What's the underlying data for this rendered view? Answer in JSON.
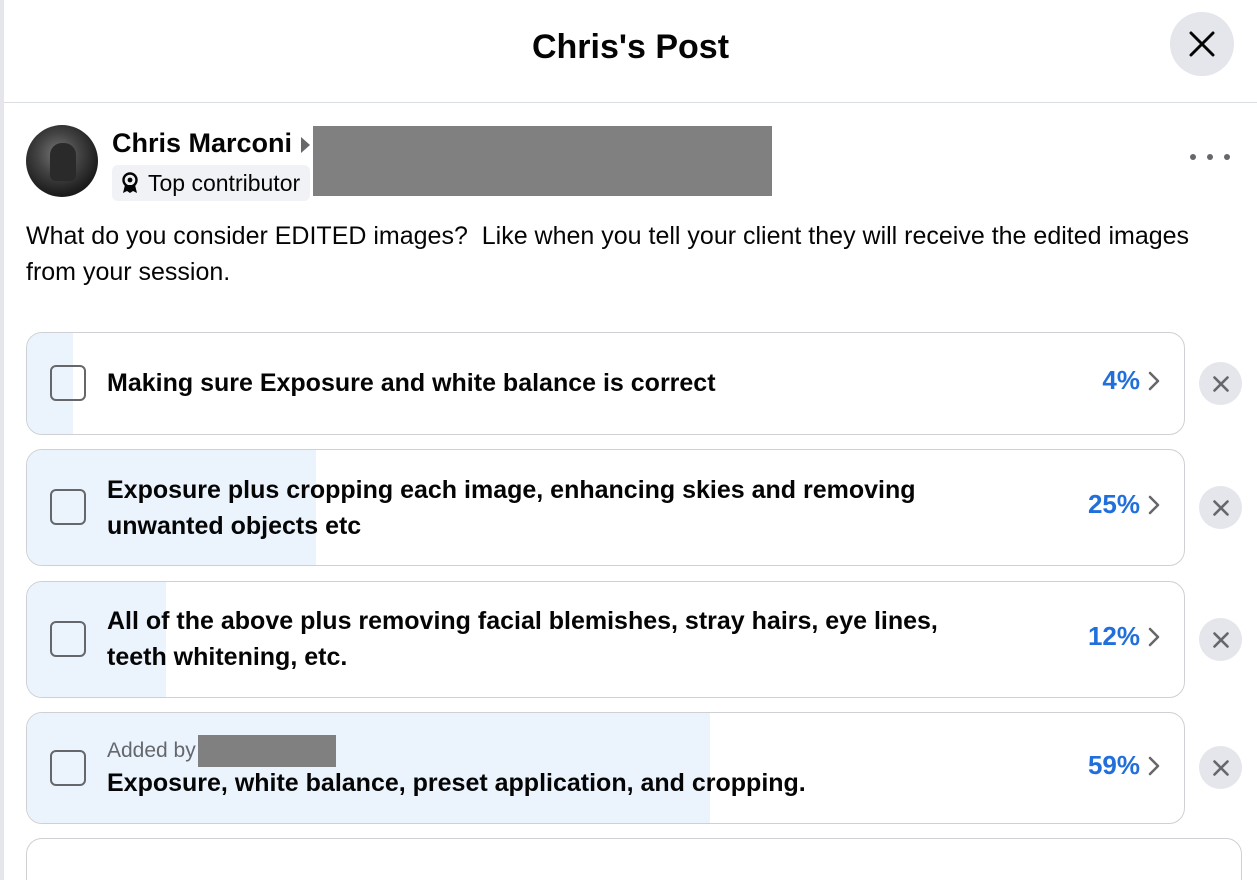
{
  "header": {
    "title": "Chris's Post"
  },
  "post": {
    "author": {
      "name": "Chris Marconi",
      "badge": "Top contributor"
    },
    "text": "What do you consider EDITED images?  Like when you tell your client they will receive the edited images from your session."
  },
  "poll": {
    "options": [
      {
        "text": "Making sure Exposure and white balance is correct",
        "percent": "4%",
        "value": 4,
        "added_by": ""
      },
      {
        "text": "Exposure plus cropping each image, enhancing skies and removing unwanted objects etc",
        "percent": "25%",
        "value": 25,
        "added_by": ""
      },
      {
        "text": "All of the above plus removing facial blemishes, stray hairs, eye lines, teeth whitening, etc.",
        "percent": "12%",
        "value": 12,
        "added_by": ""
      },
      {
        "text": "Exposure, white balance, preset application, and cropping.",
        "percent": "59%",
        "value": 59,
        "added_by": "Added by"
      }
    ],
    "add_option_placeholder": ""
  },
  "colors": {
    "accent": "#216fdb",
    "fill": "#ebf3fd",
    "border": "#ced0d4",
    "button_bg": "#e4e6eb",
    "secondary_text": "#65676b"
  },
  "icons": {
    "close": "close-icon",
    "more": "more-horizontal-icon",
    "badge": "award-icon",
    "chevron": "chevron-right-icon",
    "remove": "remove-icon"
  }
}
